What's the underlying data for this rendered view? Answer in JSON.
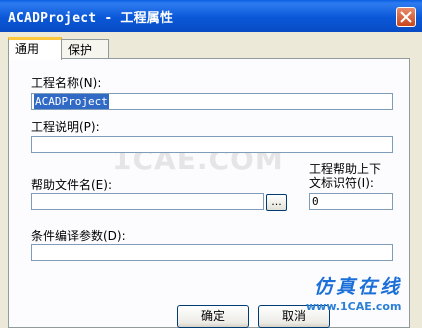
{
  "window": {
    "title": "ACADProject - 工程属性"
  },
  "tabs": [
    {
      "label": "通用"
    },
    {
      "label": "保护"
    }
  ],
  "form": {
    "project_name_label": "工程名称(N):",
    "project_name_value": "ACADProject",
    "project_desc_label": "工程说明(P):",
    "project_desc_value": "",
    "help_file_label": "帮助文件名(E):",
    "help_file_value": "",
    "browse_label": "...",
    "help_context_label_line1": "工程帮助上下",
    "help_context_label_line2": "文标识符(I):",
    "help_context_value": "0",
    "conditional_args_label": "条件编译参数(D):",
    "conditional_args_value": ""
  },
  "buttons": {
    "ok": "确定",
    "cancel": "取消"
  },
  "watermark": {
    "background_text": "1CAE.COM",
    "corner_title": "仿真在线",
    "corner_url": "www.1CAE.com"
  }
}
